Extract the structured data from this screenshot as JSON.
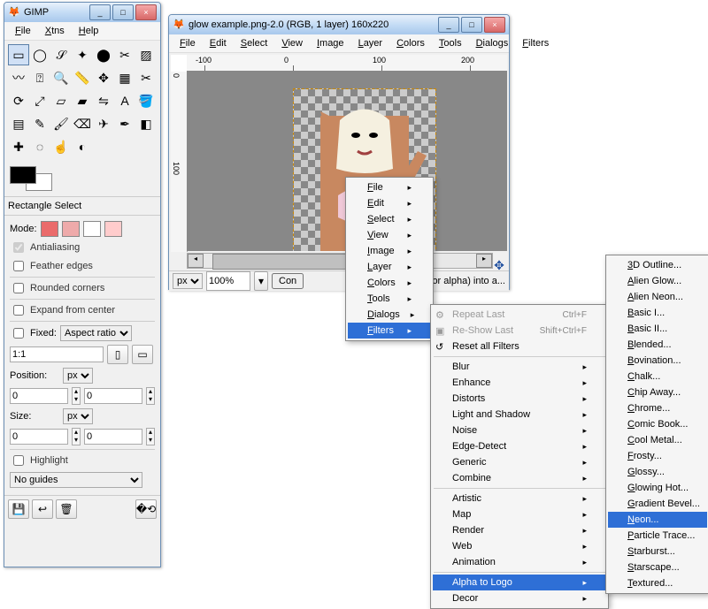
{
  "toolbox": {
    "title": "GIMP",
    "menu": [
      "File",
      "Xtns",
      "Help"
    ],
    "tool_names": [
      "rect-select",
      "ellipse-select",
      "free-select",
      "fuzzy-select",
      "by-color-select",
      "scissors",
      "foreground-select",
      "paths",
      "color-picker",
      "zoom",
      "measure",
      "move",
      "align",
      "crop",
      "rotate",
      "scale",
      "shear",
      "perspective",
      "flip",
      "text",
      "bucket-fill",
      "blend",
      "pencil",
      "paintbrush",
      "eraser",
      "airbrush",
      "ink",
      "clone",
      "heal",
      "blur",
      "smudge",
      "dodge"
    ],
    "tool_glyphs": [
      "▭",
      "◯",
      "𝒮",
      "✦",
      "⬤",
      "✂",
      "▨",
      "〰",
      "⍰",
      "🔍",
      "📏",
      "✥",
      "▦",
      "✂",
      "⟳",
      "⤢",
      "▱",
      "▰",
      "⇋",
      "A",
      "🪣",
      "▤",
      "✎",
      "🖌",
      "⌫",
      "✈",
      "✒",
      "◧",
      "✚",
      "◌",
      "☝",
      "◐"
    ],
    "section": "Rectangle Select",
    "mode_label": "Mode:",
    "antialiasing": "Antialiasing",
    "feather": "Feather edges",
    "rounded": "Rounded corners",
    "expand": "Expand from center",
    "fixed": "Fixed:",
    "fixed_select": "Aspect ratio",
    "ratio": "1:1",
    "position": "Position:",
    "position_unit": "px",
    "pos_x": "0",
    "pos_y": "0",
    "size": "Size:",
    "size_unit": "px",
    "size_w": "0",
    "size_h": "0",
    "highlight": "Highlight",
    "guides": "No guides"
  },
  "imagewin": {
    "title": "glow example.png-2.0 (RGB, 1 layer) 160x220",
    "menu": [
      "File",
      "Edit",
      "Select",
      "View",
      "Image",
      "Layer",
      "Colors",
      "Tools",
      "Dialogs",
      "Filters"
    ],
    "ruler_ticks": [
      "-100",
      "0",
      "100",
      "200"
    ],
    "ruler_v_ticks": [
      "0",
      "100"
    ],
    "unit": "px",
    "zoom": "100%",
    "status_btn": "Con",
    "status_msg": "(or alpha) into a..."
  },
  "context_menu": {
    "items": [
      "File",
      "Edit",
      "Select",
      "View",
      "Image",
      "Layer",
      "Colors",
      "Tools",
      "Dialogs",
      "Filters"
    ]
  },
  "filters_menu": {
    "repeat": "Repeat Last",
    "repeat_key": "Ctrl+F",
    "reshow": "Re-Show Last",
    "reshow_key": "Shift+Ctrl+F",
    "reset": "Reset all Filters",
    "groups": [
      "Blur",
      "Enhance",
      "Distorts",
      "Light and Shadow",
      "Noise",
      "Edge-Detect",
      "Generic",
      "Combine"
    ],
    "groups2": [
      "Artistic",
      "Map",
      "Render",
      "Web",
      "Animation"
    ],
    "groups3": [
      "Alpha to Logo",
      "Decor"
    ]
  },
  "alpha_menu": {
    "items": [
      "3D Outline...",
      "Alien Glow...",
      "Alien Neon...",
      "Basic I...",
      "Basic II...",
      "Blended...",
      "Bovination...",
      "Chalk...",
      "Chip Away...",
      "Chrome...",
      "Comic Book...",
      "Cool Metal...",
      "Frosty...",
      "Glossy...",
      "Glowing Hot...",
      "Gradient Bevel...",
      "Neon...",
      "Particle Trace...",
      "Starburst...",
      "Starscape...",
      "Textured..."
    ]
  }
}
